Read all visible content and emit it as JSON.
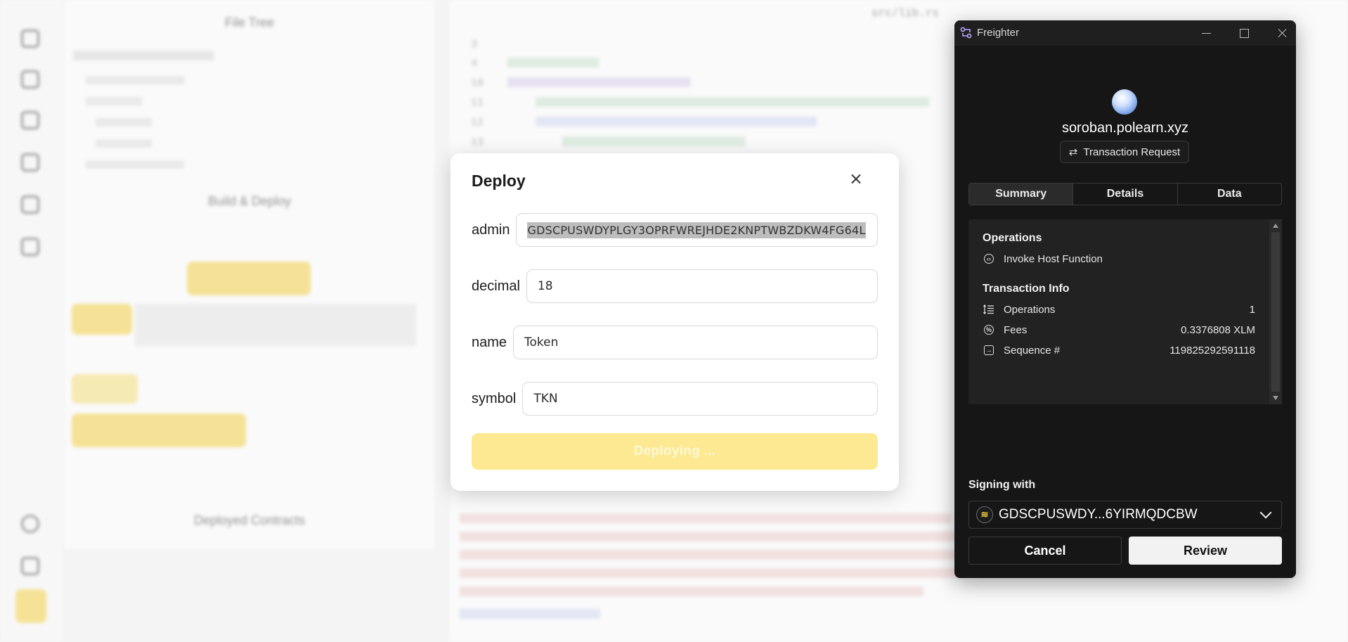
{
  "background": {
    "file_tree_title": "File Tree",
    "build_deploy_title": "Build & Deploy",
    "deployed_title": "Deployed Contracts",
    "editor_filename": "src/lib.rs"
  },
  "deploy_modal": {
    "title": "Deploy",
    "fields": [
      {
        "label": "admin",
        "value": "GDSCPUSWDYPLGY3OPRFWREJHDE2KNPTWBZDKW4FG64L"
      },
      {
        "label": "decimal",
        "value": "18"
      },
      {
        "label": "name",
        "value": "Token"
      },
      {
        "label": "symbol",
        "value": "TKN"
      }
    ],
    "deploy_button": "Deploying ..."
  },
  "freighter": {
    "window_title": "Freighter",
    "site": "soroban.polearn.xyz",
    "request_label": "Transaction Request",
    "tabs": [
      "Summary",
      "Details",
      "Data"
    ],
    "active_tab": "Summary",
    "operations_title": "Operations",
    "operation_item": "Invoke Host Function",
    "tx_info_title": "Transaction Info",
    "tx_info": [
      {
        "label": "Operations",
        "value": "1",
        "icon": "list-icon"
      },
      {
        "label": "Fees",
        "value": "0.3376808 XLM",
        "icon": "percent-icon"
      },
      {
        "label": "Sequence #",
        "value": "119825292591118",
        "icon": "arrow-in-icon"
      }
    ],
    "signing_label": "Signing with",
    "account": "GDSCPUSWDY...6YIRMQDCBW",
    "cancel_label": "Cancel",
    "review_label": "Review",
    "colors": {
      "background": "#161616",
      "panel": "#222222",
      "review_button": "#f2f2f2"
    }
  }
}
